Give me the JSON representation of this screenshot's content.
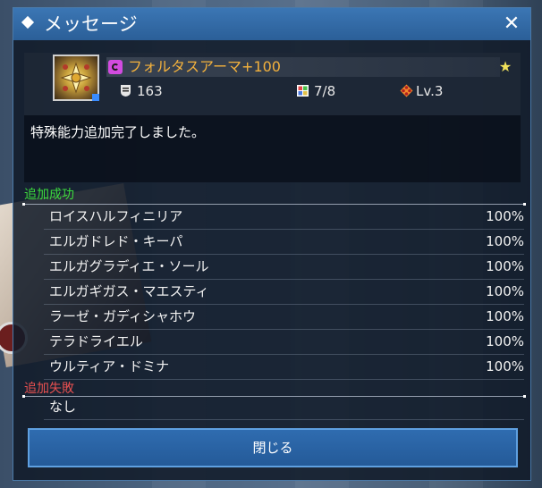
{
  "window": {
    "title": "メッセージ",
    "close_glyph": "✕"
  },
  "item": {
    "name": "フォルタスアーマ+100",
    "name_color": "#f3b13d",
    "type_icon": "armor-type-icon",
    "defense": "163",
    "slots": "7/8",
    "level": "Lv.3",
    "fav_icon": "favorite-star-icon"
  },
  "message": "特殊能力追加完了しました。",
  "success": {
    "label": "追加成功",
    "color": "#3ddc3d",
    "rows": [
      {
        "name": "ロイスハルフィニリア",
        "pct": "100%"
      },
      {
        "name": "エルガドレド・キーパ",
        "pct": "100%"
      },
      {
        "name": "エルガグラディエ・ソール",
        "pct": "100%"
      },
      {
        "name": "エルガギガス・マエスティ",
        "pct": "100%"
      },
      {
        "name": "ラーゼ・ガディシャホウ",
        "pct": "100%"
      },
      {
        "name": "テラドライエル",
        "pct": "100%"
      },
      {
        "name": "ウルティア・ドミナ",
        "pct": "100%"
      }
    ]
  },
  "failure": {
    "label": "追加失敗",
    "color": "#e85050",
    "rows": [
      {
        "name": "なし"
      }
    ]
  },
  "buttons": {
    "close_label": "閉じる"
  }
}
